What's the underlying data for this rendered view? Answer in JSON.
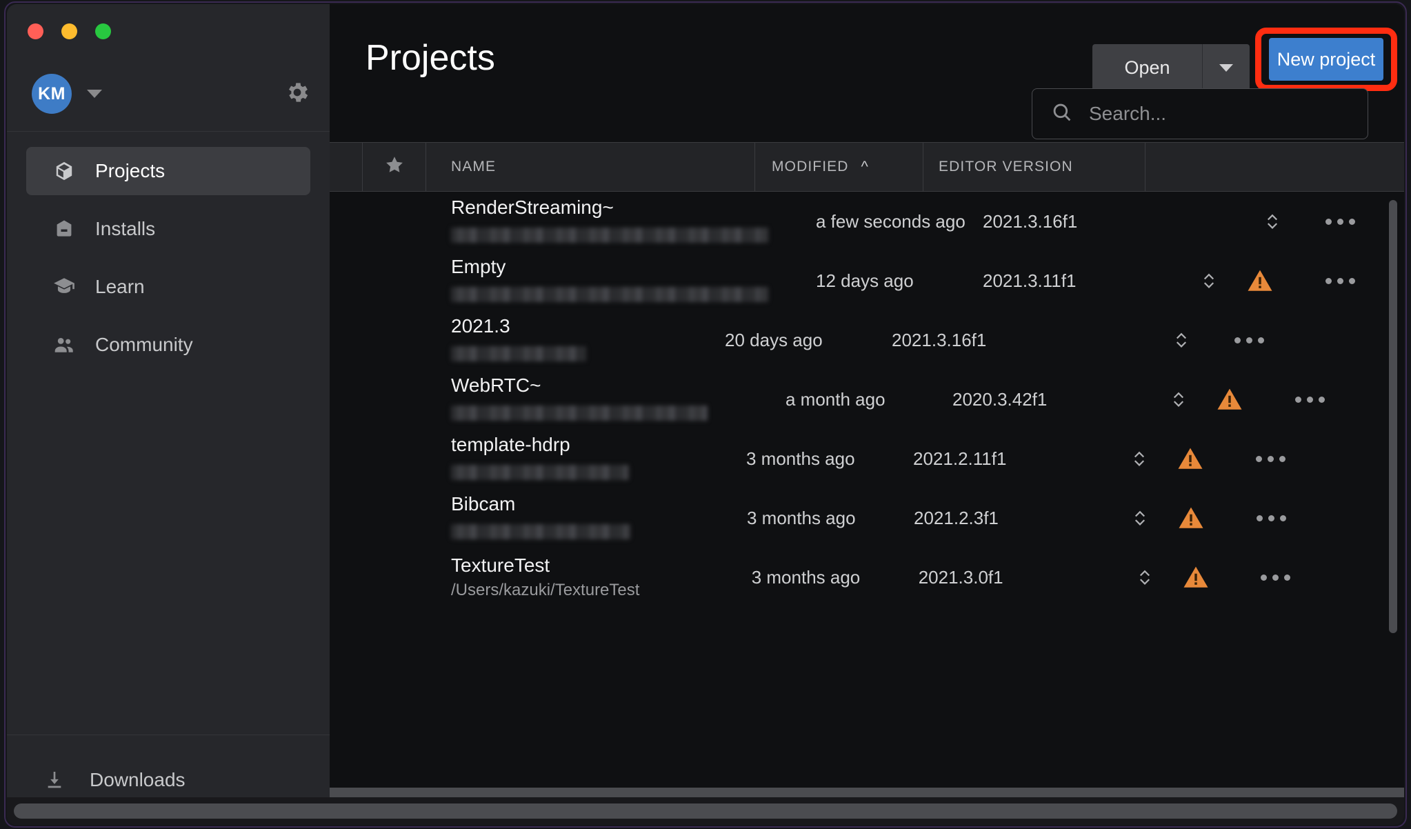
{
  "window": {
    "traffic_lights": [
      "close",
      "minimize",
      "zoom"
    ],
    "colors": {
      "accent_blue": "#3d7fce",
      "highlight_red": "#ff2d11",
      "warning_orange": "#e8893a",
      "avatar_blue": "#3e7cc6"
    }
  },
  "sidebar": {
    "account": {
      "initials": "KM",
      "dropdown_icon": "chevron-down-icon",
      "settings_icon": "gear-icon"
    },
    "items": [
      {
        "label": "Projects",
        "icon": "cube-icon",
        "active": true
      },
      {
        "label": "Installs",
        "icon": "archive-icon",
        "active": false
      },
      {
        "label": "Learn",
        "icon": "graduation-cap-icon",
        "active": false
      },
      {
        "label": "Community",
        "icon": "people-icon",
        "active": false
      }
    ],
    "downloads": {
      "label": "Downloads",
      "icon": "download-icon"
    }
  },
  "header": {
    "title": "Projects",
    "open_label": "Open",
    "open_dropdown_icon": "chevron-down-icon",
    "new_project_label": "New project",
    "new_project_highlighted": true
  },
  "search": {
    "placeholder": "Search...",
    "value": "",
    "icon": "search-icon"
  },
  "table": {
    "columns": [
      {
        "key": "star",
        "label": "",
        "icon": "star-icon"
      },
      {
        "key": "name",
        "label": "NAME"
      },
      {
        "key": "modified",
        "label": "MODIFIED",
        "sorted": "asc",
        "sort_icon": "caret-up-icon"
      },
      {
        "key": "editor_version",
        "label": "EDITOR VERSION"
      }
    ],
    "rows": [
      {
        "name": "RenderStreaming~",
        "path": "",
        "path_redacted": true,
        "path_width": 460,
        "modified": "a few seconds ago",
        "editor_version": "2021.3.16f1",
        "warning": false
      },
      {
        "name": "Empty",
        "path": "",
        "path_redacted": true,
        "path_width": 460,
        "modified": "12 days ago",
        "editor_version": "2021.3.11f1",
        "warning": true
      },
      {
        "name": "2021.3",
        "path": "",
        "path_redacted": true,
        "path_width": 196,
        "modified": "20 days ago",
        "editor_version": "2021.3.16f1",
        "warning": false
      },
      {
        "name": "WebRTC~",
        "path": "",
        "path_redacted": true,
        "path_width": 372,
        "modified": "a month ago",
        "editor_version": "2020.3.42f1",
        "warning": true
      },
      {
        "name": "template-hdrp",
        "path": "",
        "path_redacted": true,
        "path_width": 258,
        "modified": "3 months ago",
        "editor_version": "2021.2.11f1",
        "warning": true
      },
      {
        "name": "Bibcam",
        "path": "",
        "path_redacted": true,
        "path_width": 260,
        "modified": "3 months ago",
        "editor_version": "2021.2.3f1",
        "warning": true
      },
      {
        "name": "TextureTest",
        "path": "/Users/kazuki/TextureTest",
        "path_redacted": false,
        "path_width": 0,
        "modified": "3 months ago",
        "editor_version": "2021.3.0f1",
        "warning": true
      }
    ],
    "row_icons": {
      "sort_handle": "chevron-up-down-icon",
      "warning": "warning-triangle-icon",
      "menu": "ellipsis-icon"
    }
  }
}
